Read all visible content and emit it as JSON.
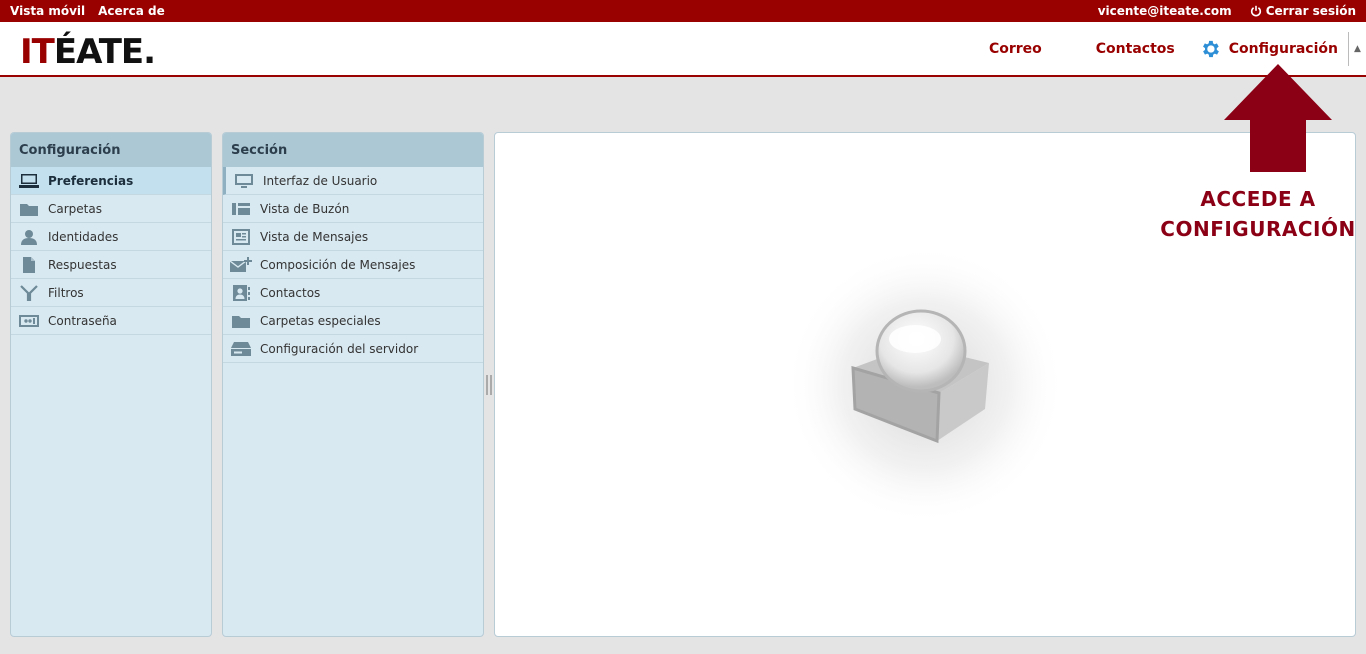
{
  "topbar": {
    "links": [
      "Vista móvil",
      "Acerca de"
    ],
    "user_email": "vicente@iteate.com",
    "logout_label": "Cerrar sesión"
  },
  "logo": {
    "part1": "IT",
    "part2": "ÉATE."
  },
  "nav": {
    "mail": "Correo",
    "contacts": "Contactos",
    "settings": "Configuración"
  },
  "settings_panel": {
    "title": "Configuración",
    "items": [
      {
        "label": "Preferencias",
        "icon": "monitor-icon",
        "selected": true
      },
      {
        "label": "Carpetas",
        "icon": "folder-icon"
      },
      {
        "label": "Identidades",
        "icon": "person-icon"
      },
      {
        "label": "Respuestas",
        "icon": "document-icon"
      },
      {
        "label": "Filtros",
        "icon": "filter-icon"
      },
      {
        "label": "Contraseña",
        "icon": "password-icon"
      }
    ]
  },
  "section_panel": {
    "title": "Sección",
    "items": [
      {
        "label": "Interfaz de Usuario",
        "icon": "monitor-icon"
      },
      {
        "label": "Vista de Buzón",
        "icon": "mailbox-view-icon"
      },
      {
        "label": "Vista de Mensajes",
        "icon": "message-view-icon"
      },
      {
        "label": "Composición de Mensajes",
        "icon": "compose-icon"
      },
      {
        "label": "Contactos",
        "icon": "contacts-icon"
      },
      {
        "label": "Carpetas especiales",
        "icon": "folder-icon"
      },
      {
        "label": "Configuración del servidor",
        "icon": "server-icon"
      }
    ]
  },
  "annotation": {
    "line1": "ACCEDE A",
    "line2": "CONFIGURACIÓN",
    "color": "#8b0015"
  },
  "colors": {
    "brand": "#990000",
    "panel_bg": "#d9e9f1",
    "panel_header": "#acc8d5"
  }
}
